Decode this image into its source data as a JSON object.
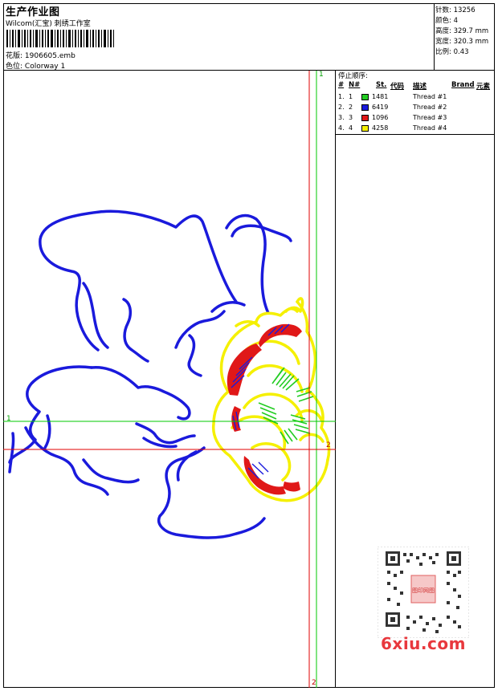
{
  "header": {
    "title": "生产作业图",
    "studio": "Wilcom(汇宝) 刺绣工作室",
    "design_label": "花版:",
    "design_value": "1906605.emb",
    "colorway_label": "色位:",
    "colorway_value": "Colorway 1"
  },
  "stats": [
    {
      "label": "针数:",
      "value": "13256"
    },
    {
      "label": "颜色:",
      "value": "4"
    },
    {
      "label": "高度:",
      "value": "329.7 mm"
    },
    {
      "label": "宽度:",
      "value": "320.3 mm"
    },
    {
      "label": "比例:",
      "value": "0.43"
    }
  ],
  "stop_sequence": {
    "heading": "停止顺序:",
    "columns": {
      "num": "#",
      "n": "N#",
      "st": "St.",
      "code": "代码",
      "desc": "描述",
      "brand": "Brand",
      "element": "元素"
    },
    "rows": [
      {
        "num": "1.",
        "n": "1",
        "color": "#22cc22",
        "code": "1481",
        "desc": "Thread #1"
      },
      {
        "num": "2.",
        "n": "2",
        "color": "#1a1adc",
        "code": "6419",
        "desc": "Thread #2"
      },
      {
        "num": "3.",
        "n": "3",
        "color": "#e01818",
        "code": "1096",
        "desc": "Thread #3"
      },
      {
        "num": "4.",
        "n": "4",
        "color": "#f5f000",
        "code": "4258",
        "desc": "Thread #4"
      }
    ]
  },
  "guides": {
    "green_v": "1",
    "green_h": "1",
    "red_h": "2",
    "red_v": "2"
  },
  "watermark": "6xiu.com",
  "qr_stamp": "图印网图",
  "colors": {
    "blue": "#1a1adc",
    "red": "#e01818",
    "green": "#22cc22",
    "yellow": "#f5f000",
    "guide_red": "#e00000",
    "guide_green": "#00c800"
  }
}
